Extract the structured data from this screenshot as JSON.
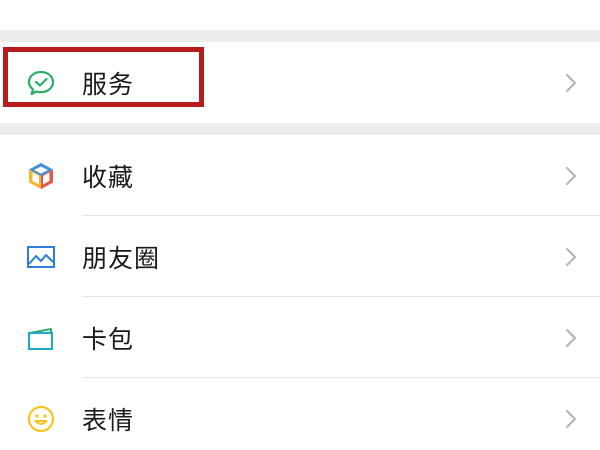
{
  "menu": {
    "service": {
      "label": "服务",
      "icon": "service-icon",
      "color": "#2aae67"
    },
    "favorites": {
      "label": "收藏",
      "icon": "favorites-cube-icon"
    },
    "moments": {
      "label": "朋友圈",
      "icon": "moments-image-icon",
      "color": "#2f7ed8"
    },
    "cards": {
      "label": "卡包",
      "icon": "card-wallet-icon",
      "color": "#1fa8c9"
    },
    "stickers": {
      "label": "表情",
      "icon": "smiley-icon",
      "color": "#f5c518"
    }
  },
  "highlight": {
    "target": "service",
    "color": "#b71c1c"
  }
}
